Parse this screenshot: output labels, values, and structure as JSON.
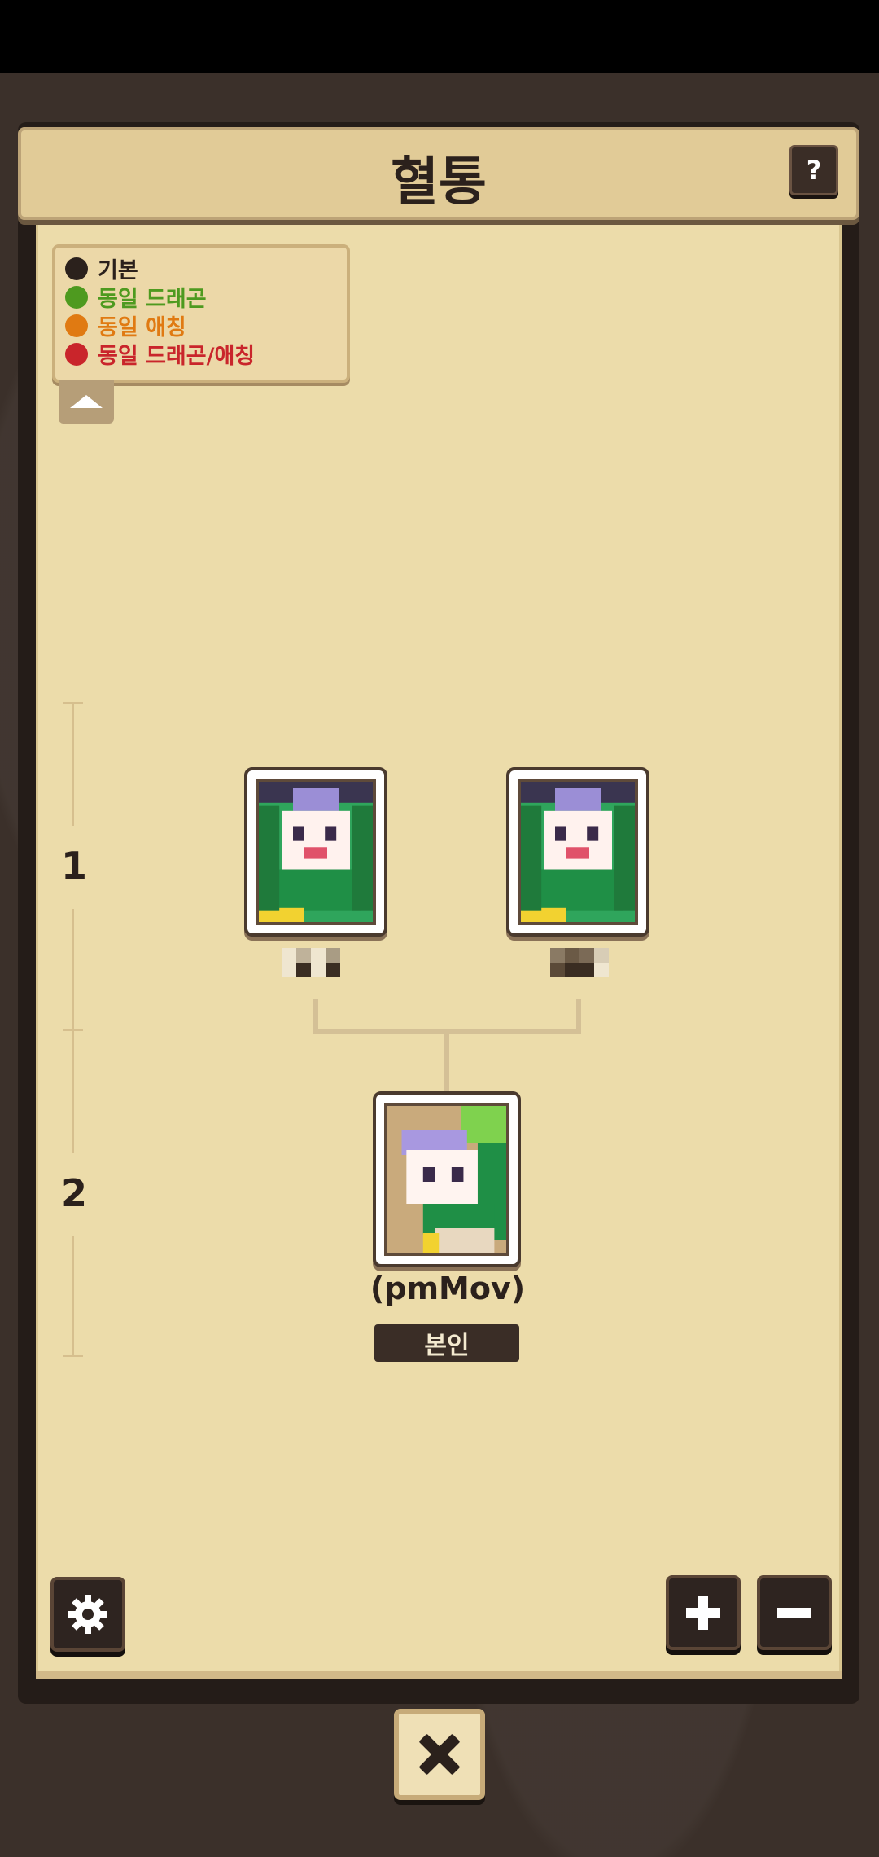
{
  "header": {
    "title": "혈통",
    "help_label": "?"
  },
  "legend": {
    "items": [
      {
        "label": "기본",
        "color": "#2b211c"
      },
      {
        "label": "동일 드래곤",
        "color": "#4e9a1f"
      },
      {
        "label": "동일 애칭",
        "color": "#e07a12"
      },
      {
        "label": "동일 드래곤/애칭",
        "color": "#c9252b"
      }
    ]
  },
  "generations": [
    "1",
    "2"
  ],
  "tree": {
    "parents": [
      {
        "icon": "dragon-portrait-icon"
      },
      {
        "icon": "dragon-portrait-icon"
      }
    ],
    "self": {
      "name": "(pmMov)",
      "badge": "본인",
      "icon": "dragon-portrait-icon"
    }
  },
  "controls": {
    "settings_icon": "gear-icon",
    "zoom_in_icon": "plus-icon",
    "zoom_out_icon": "minus-icon",
    "close_icon": "close-icon"
  }
}
